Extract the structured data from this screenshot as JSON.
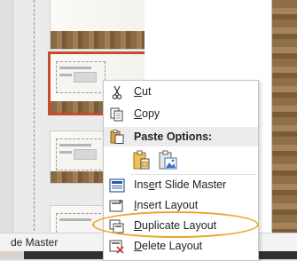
{
  "thumbnail_pane": {
    "slides": [
      {
        "name": "layout-thumbnail"
      },
      {
        "name": "layout-thumbnail-selected"
      },
      {
        "name": "layout-thumbnail"
      },
      {
        "name": "layout-thumbnail"
      }
    ]
  },
  "statusbar": {
    "view_label": "de Master"
  },
  "context_menu": {
    "cut": {
      "label": "Cut",
      "icon": "scissors-icon"
    },
    "copy": {
      "label": "Copy",
      "icon": "copy-icon"
    },
    "paste_options": {
      "label": "Paste Options:",
      "icon": "paste-icon",
      "buttons": [
        {
          "icon": "paste-use-destination-theme-icon"
        },
        {
          "icon": "paste-picture-icon"
        }
      ]
    },
    "insert_slide_master": {
      "label": "Insert Slide Master",
      "icon": "insert-slide-master-icon"
    },
    "insert_layout": {
      "label": "Insert Layout",
      "icon": "insert-layout-icon"
    },
    "duplicate_layout": {
      "label": "Duplicate Layout",
      "icon": "duplicate-layout-icon"
    },
    "delete_layout": {
      "label": "Delete Layout",
      "icon": "delete-layout-icon"
    }
  },
  "colors": {
    "selection_border": "#c84b2e",
    "highlight_oval": "#e8a530",
    "menu_background": "#ffffff"
  }
}
